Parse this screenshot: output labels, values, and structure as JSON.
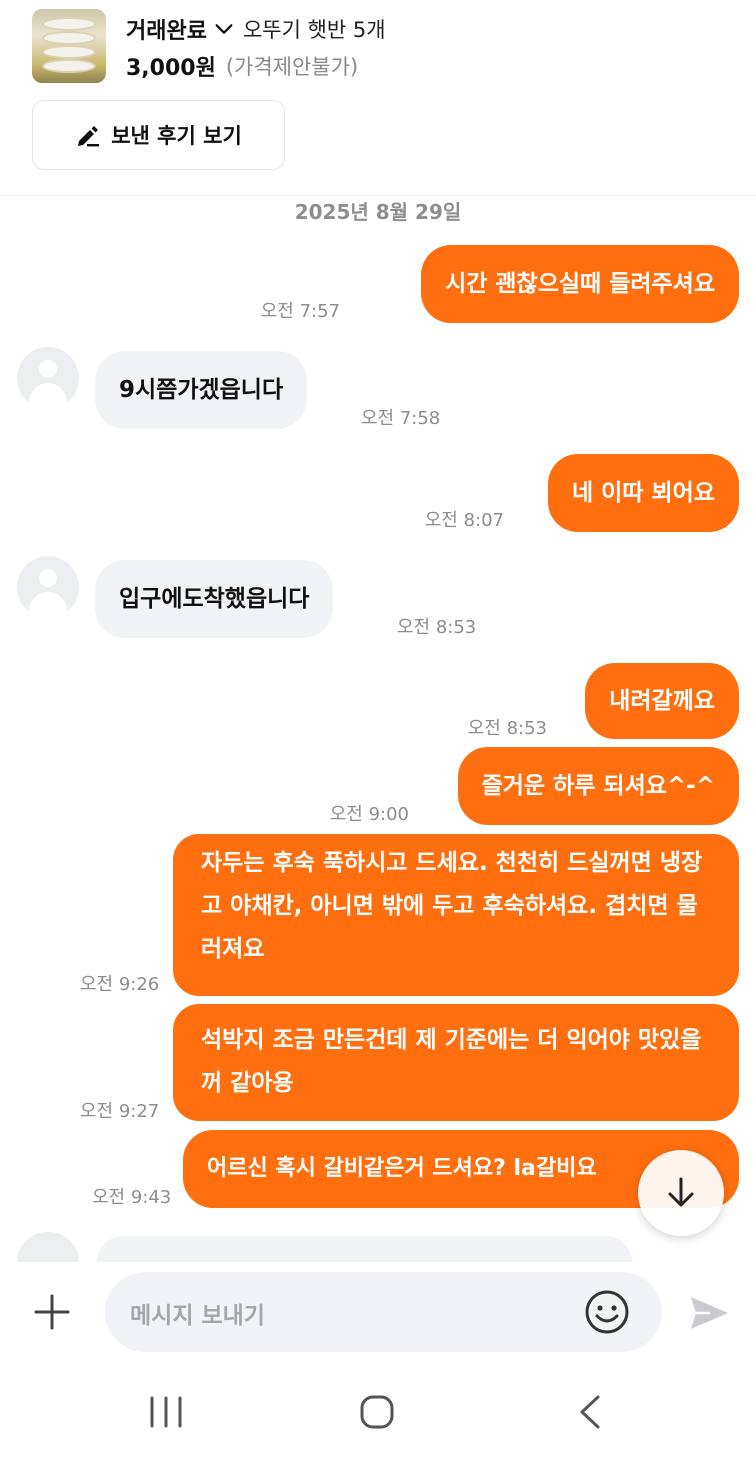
{
  "header": {
    "status_label": "거래완료",
    "product_name": "오뚜기 햇반 5개",
    "price": "3,000원",
    "price_note": "(가격제안불가)",
    "review_button_label": "보낸 후기 보기"
  },
  "chat": {
    "date": "2025년 8월 29일",
    "messages": [
      {
        "side": "out",
        "text": "시간 괜찮으실때 들려주셔요",
        "time": "오전 7:57"
      },
      {
        "side": "in",
        "text": "9시쯤가겠읍니다",
        "time": "오전 7:58"
      },
      {
        "side": "out",
        "text": "네 이따 뵈어요",
        "time": "오전 8:07"
      },
      {
        "side": "in",
        "text": "입구에도착했읍니다",
        "time": "오전 8:53"
      },
      {
        "side": "out",
        "text": "내려갈께요",
        "time": "오전 8:53"
      },
      {
        "side": "out",
        "text": "즐거운 하루 되셔요^-^",
        "time": "오전 9:00"
      },
      {
        "side": "out",
        "text": "자두는 후숙 푹하시고 드세요. 천천히 드실꺼면 냉장고 야채칸, 아니면 밖에 두고 후숙하셔요. 겹치면 물러져요",
        "time": "오전 9:26"
      },
      {
        "side": "out",
        "text": "석박지 조금 만든건데 제 기준에는 더 익어야 맛있을꺼 같아용",
        "time": "오전 9:27"
      },
      {
        "side": "out",
        "text": "어르신 혹시 갈비같은거 드셔요? la갈비요",
        "time": "오전 9:43"
      }
    ]
  },
  "input": {
    "placeholder": "메시지 보내기"
  },
  "colors": {
    "accent": "#ff6f0f",
    "incoming_bubble": "#f2f3f6",
    "muted_text": "#8e8e8e"
  },
  "icons": {
    "status_dropdown": "chevron-down-icon",
    "review": "pencil-icon",
    "scroll_down": "arrow-down-icon",
    "attach": "plus-icon",
    "emoji": "smiley-icon",
    "send": "send-icon",
    "nav_recent": "recent-apps-icon",
    "nav_home": "home-icon",
    "nav_back": "back-icon"
  }
}
